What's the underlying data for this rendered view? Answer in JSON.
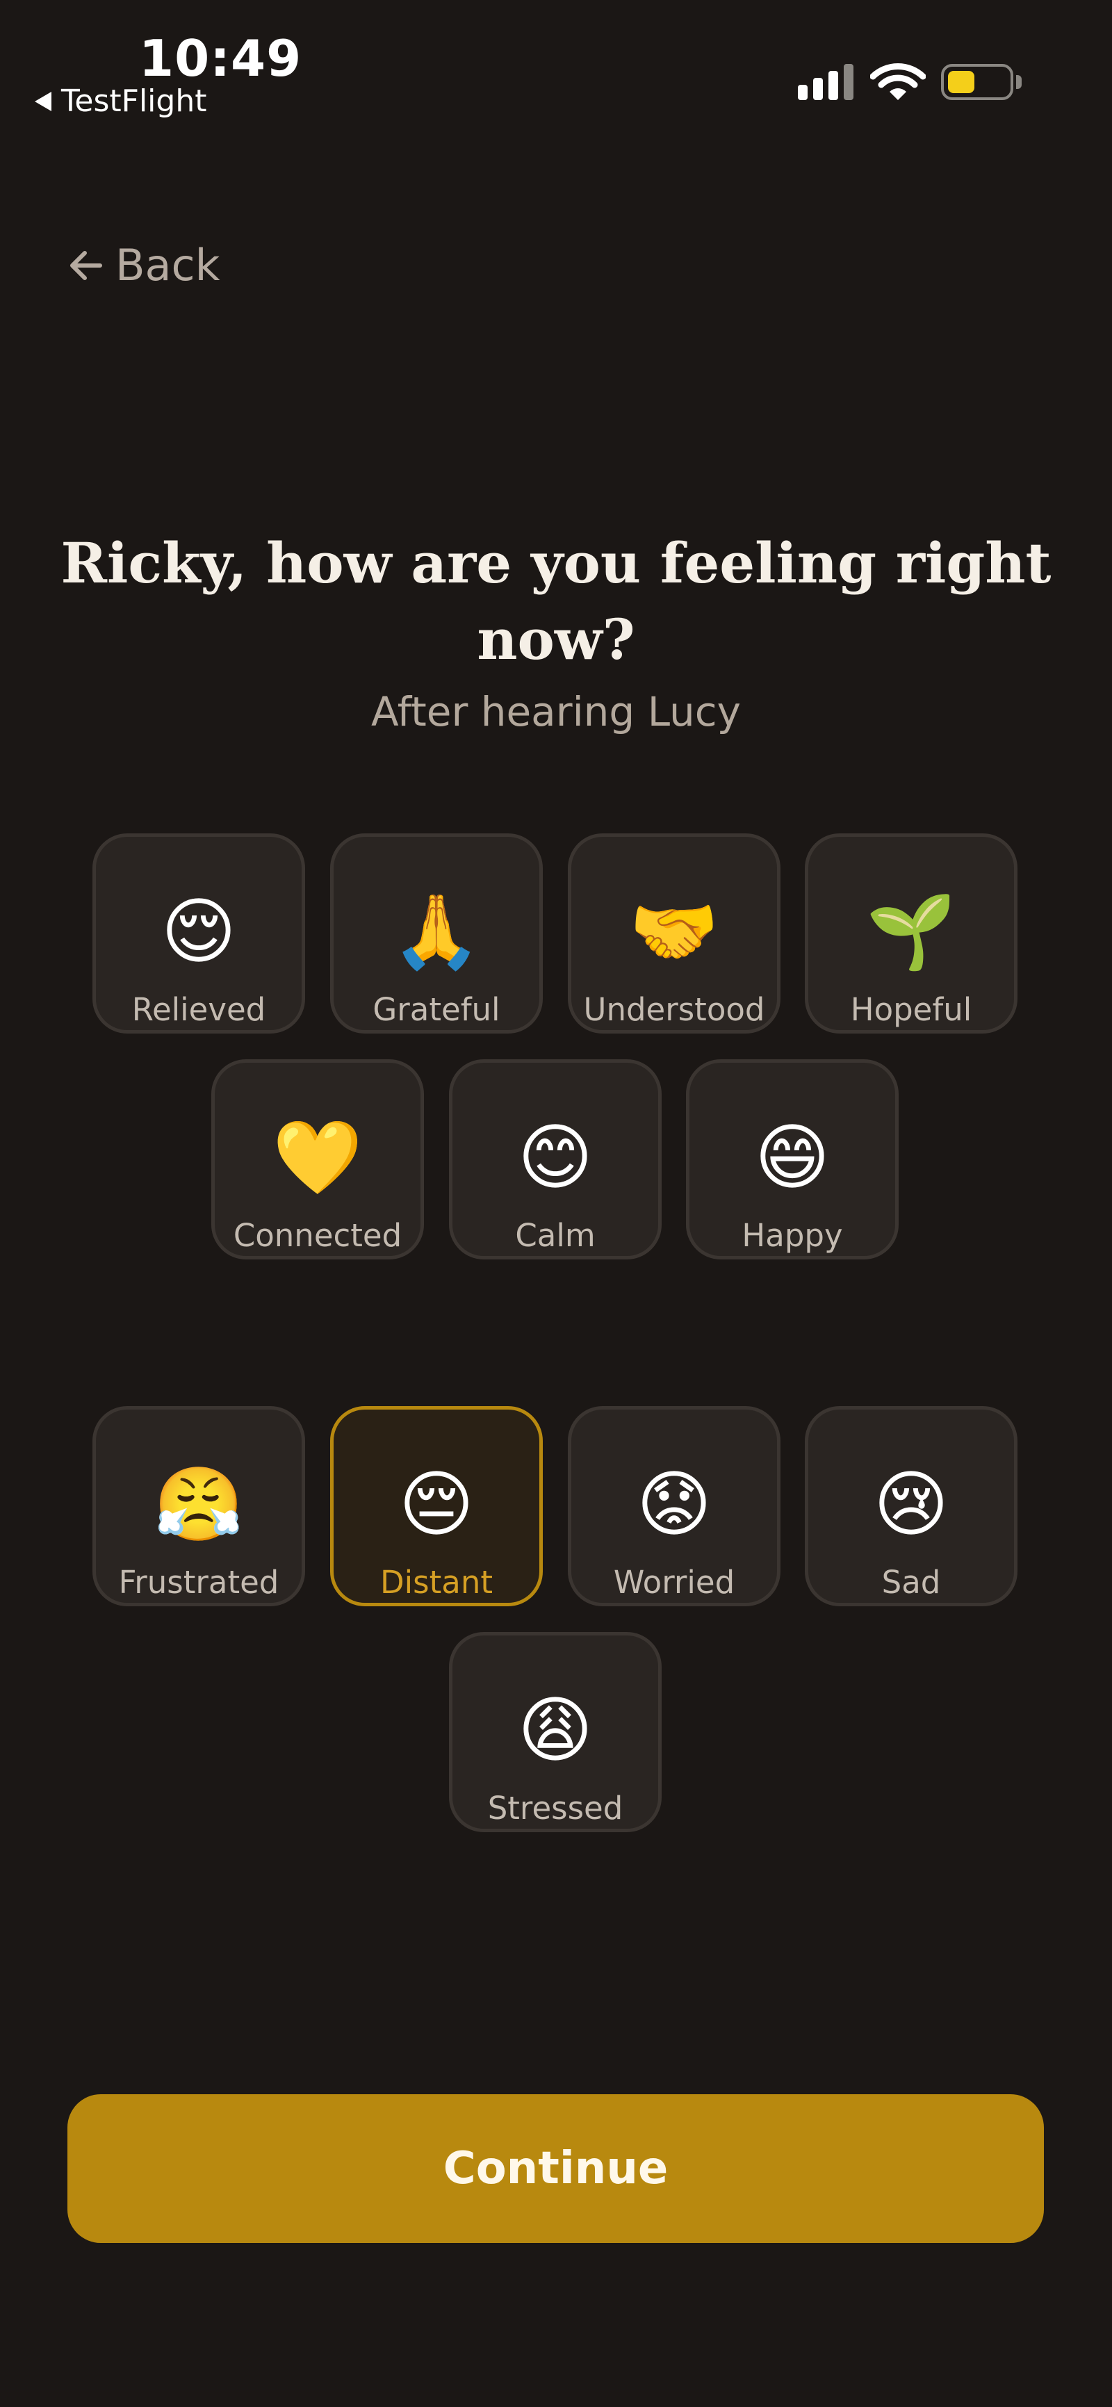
{
  "status_bar": {
    "time": "10:49",
    "back_app": "TestFlight"
  },
  "nav": {
    "back_label": "Back"
  },
  "header": {
    "title": "Ricky, how are you feeling right now?",
    "subtitle": "After hearing Lucy"
  },
  "positive_emotions": [
    {
      "label": "Relieved",
      "emoji": "😌"
    },
    {
      "label": "Grateful",
      "emoji": "🙏"
    },
    {
      "label": "Understood",
      "emoji": "🤝"
    },
    {
      "label": "Hopeful",
      "emoji": "🌱"
    },
    {
      "label": "Connected",
      "emoji": "💛"
    },
    {
      "label": "Calm",
      "emoji": "😊"
    },
    {
      "label": "Happy",
      "emoji": "😄"
    }
  ],
  "negative_emotions": [
    {
      "label": "Frustrated",
      "emoji": "😤"
    },
    {
      "label": "Distant",
      "emoji": "😔",
      "selected": true
    },
    {
      "label": "Worried",
      "emoji": "😟"
    },
    {
      "label": "Sad",
      "emoji": "😢"
    },
    {
      "label": "Stressed",
      "emoji": "😩"
    }
  ],
  "continue_label": "Continue",
  "colors": {
    "background": "#1b1715",
    "accent": "#b8890f",
    "card": "#2a2522"
  }
}
